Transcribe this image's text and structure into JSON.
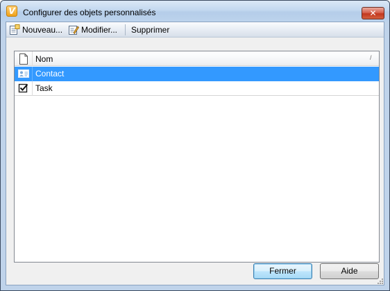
{
  "window": {
    "title": "Configurer des objets personnalisés",
    "app_icon_letter": "V",
    "close_glyph": "✕"
  },
  "toolbar": {
    "new_label": "Nouveau...",
    "new_icon": "new-document-icon",
    "modify_label": "Modifier...",
    "modify_icon": "edit-icon",
    "delete_label": "Supprimer"
  },
  "list": {
    "header_icon": "document-icon",
    "column_name": "Nom",
    "sort_indicator": "/",
    "rows": [
      {
        "icon": "contact-card-icon",
        "name": "Contact",
        "selected": true
      },
      {
        "icon": "task-checkbox-icon",
        "name": "Task",
        "selected": false
      }
    ]
  },
  "buttons": {
    "close_label": "Fermer",
    "help_label": "Aide"
  },
  "colors": {
    "selection": "#3399ff",
    "title_bar": "#c3d8ef",
    "close_button": "#c2381f"
  }
}
